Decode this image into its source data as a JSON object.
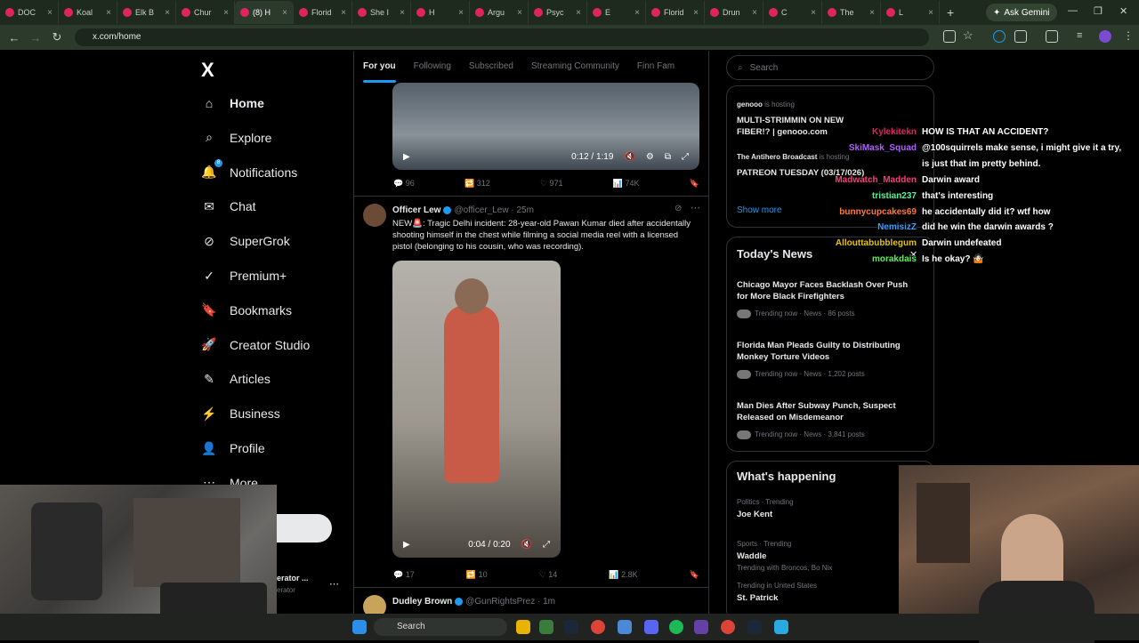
{
  "browser": {
    "tabs": [
      {
        "label": "DOC"
      },
      {
        "label": "Koal"
      },
      {
        "label": "Elk B"
      },
      {
        "label": "Chur"
      },
      {
        "label": "(8) H"
      },
      {
        "label": "Florid"
      },
      {
        "label": "She I"
      },
      {
        "label": "H"
      },
      {
        "label": "Argu"
      },
      {
        "label": "Psyc"
      },
      {
        "label": "E"
      },
      {
        "label": "Florid"
      },
      {
        "label": "Drun"
      },
      {
        "label": "C"
      },
      {
        "label": "The"
      },
      {
        "label": "L"
      }
    ],
    "active_tab_index": 4,
    "new_tab": "+",
    "ask_gemini": "Ask Gemini",
    "url": "x.com/home",
    "window_controls": [
      "—",
      "❐",
      "✕"
    ]
  },
  "sidebar": {
    "logo": "X",
    "items": [
      {
        "label": "Home",
        "icon": "home-icon"
      },
      {
        "label": "Explore",
        "icon": "search-icon"
      },
      {
        "label": "Notifications",
        "icon": "bell-icon"
      },
      {
        "label": "Chat",
        "icon": "mail-icon"
      },
      {
        "label": "SuperGrok",
        "icon": "grok-icon"
      },
      {
        "label": "Premium+",
        "icon": "premium-icon"
      },
      {
        "label": "Bookmarks",
        "icon": "bookmark-icon"
      },
      {
        "label": "Creator Studio",
        "icon": "rocket-icon"
      },
      {
        "label": "Articles",
        "icon": "articles-icon"
      },
      {
        "label": "Business",
        "icon": "lightning-icon"
      },
      {
        "label": "Profile",
        "icon": "person-icon"
      },
      {
        "label": "More",
        "icon": "more-icon"
      }
    ],
    "notification_badge": "8",
    "account_name": "erator ...",
    "account_handle": "erator"
  },
  "feed": {
    "tabs": [
      "For you",
      "Following",
      "Subscribed",
      "Streaming Community",
      "Finn Fam"
    ],
    "active_tab": 0,
    "video1": {
      "time": "0:12 / 1:19",
      "replies": "96",
      "reposts": "312",
      "likes": "971",
      "views": "74K"
    },
    "tweet2": {
      "name": "Officer Lew",
      "handle": "@officer_Lew · 25m",
      "text": "NEW🚨: Tragic Delhi incident: 28-year-old Pawan Kumar died after accidentally shooting himself in the chest while filming a social media reel with a licensed pistol (belonging to his cousin, who was recording).",
      "video_time": "0:04 / 0:20",
      "replies": "17",
      "reposts": "10",
      "likes": "14",
      "views": "2.8K"
    },
    "tweet3": {
      "name": "Dudley Brown",
      "handle": "@GunRightsPrez · 1m"
    }
  },
  "right": {
    "search_placeholder": "Search",
    "live": [
      {
        "host": "genooo",
        "status": "is hosting",
        "title": "MULTI-STRIMMIN ON NEW FIBER!? | genooo.com"
      },
      {
        "host": "The Antihero Broadcast",
        "status": "is hosting",
        "title": "PATREON TUESDAY (03/17/026)"
      }
    ],
    "show_more": "Show more",
    "news_title": "Today's News",
    "news": [
      {
        "title": "Chicago Mayor Faces Backlash Over Push for More Black Firefighters",
        "meta": "Trending now · News · 86 posts"
      },
      {
        "title": "Florida Man Pleads Guilty to Distributing Monkey Torture Videos",
        "meta": "Trending now · News · 1,202 posts"
      },
      {
        "title": "Man Dies After Subway Punch, Suspect Released on Misdemeanor",
        "meta": "Trending now · News · 3,841 posts"
      }
    ],
    "happening_title": "What's happening",
    "trends": [
      {
        "context": "Politics · Trending",
        "name": "Joe Kent",
        "extra": ""
      },
      {
        "context": "Sports · Trending",
        "name": "Waddle",
        "extra": "Trending with Broncos, Bo Nix"
      },
      {
        "context": "Trending in United States",
        "name": "St. Patrick",
        "extra": ""
      }
    ]
  },
  "chat": [
    {
      "user": "Kylekitekn",
      "msg": "HOW IS THAT AN ACCIDENT?",
      "color": "#e0245e"
    },
    {
      "user": "SkiMask_Squad",
      "msg": "@100squirrels make sense, i might give it a try,",
      "color": "#b25fff"
    },
    {
      "user": "",
      "msg": "is just that im pretty behind.",
      "color": "#ffffff"
    },
    {
      "user": "Madwatch_Madden",
      "msg": "Darwin award",
      "color": "#ff3b7a"
    },
    {
      "user": "tristian237",
      "msg": "that's interesting",
      "color": "#5cf09a"
    },
    {
      "user": "bunnycupcakes69",
      "msg": "he accidentally did it? wtf how",
      "color": "#ff7a3d"
    },
    {
      "user": "NemisizZ",
      "msg": "did he win the darwin awards ?",
      "color": "#3aa0ff"
    },
    {
      "user": "Allouttabubblegum",
      "msg": "Darwin undefeated",
      "color": "#e6c200"
    },
    {
      "user": "morakdais",
      "msg": "Is he okay? 🤷🏻",
      "color": "#5cf05c"
    }
  ],
  "taskbar": {
    "search": "Search"
  }
}
